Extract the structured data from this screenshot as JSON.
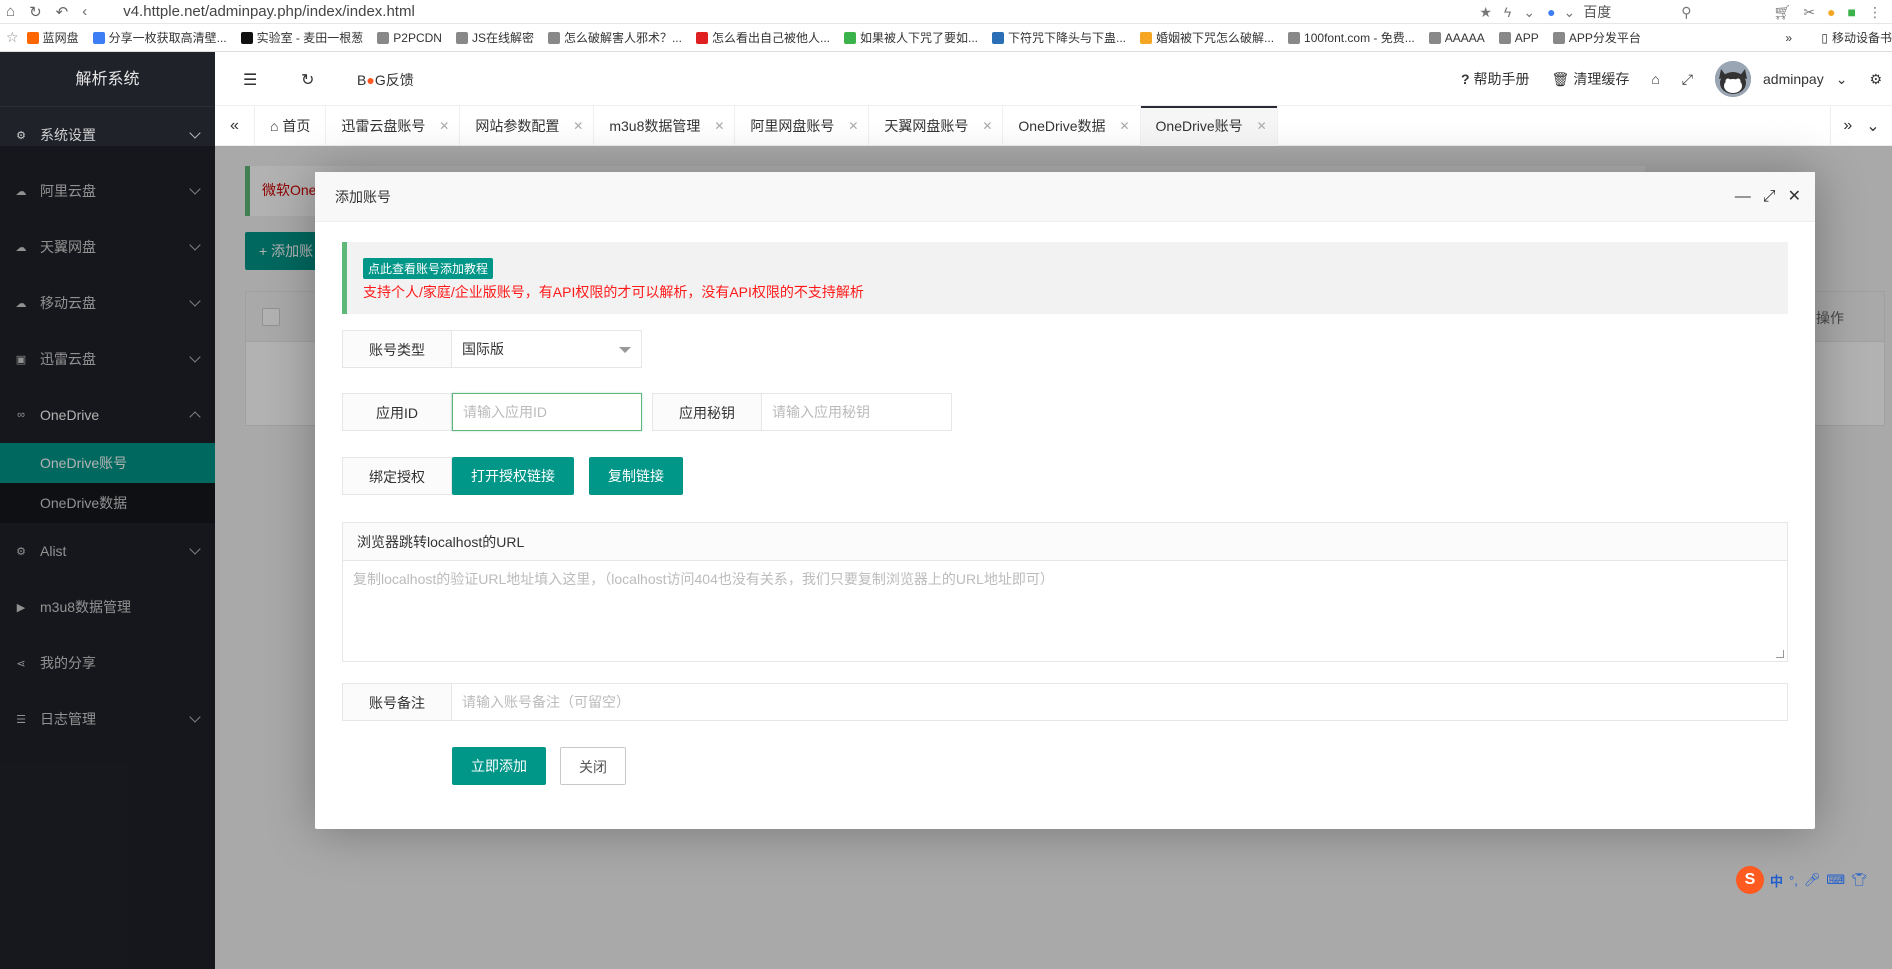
{
  "browser": {
    "url": "v4.httple.net/adminpay.php/index/index.html",
    "search_engine_label": "百度",
    "bookmarks": [
      {
        "label": "蓝网盘",
        "color": "#ff6600"
      },
      {
        "label": "分享一枚获取高清壁...",
        "color": "#3d7ef5"
      },
      {
        "label": "实验室 - 麦田一根葱",
        "color": "#111111"
      },
      {
        "label": "P2PCDN",
        "color": "#888888"
      },
      {
        "label": "JS在线解密",
        "color": "#888888"
      },
      {
        "label": "怎么破解害人邪术？...",
        "color": "#888888"
      },
      {
        "label": "怎么看出自己被他人...",
        "color": "#e02020"
      },
      {
        "label": "如果被人下咒了要如...",
        "color": "#3bb34a"
      },
      {
        "label": "下符咒下降头与下蛊...",
        "color": "#2a6fb5"
      },
      {
        "label": "婚姻被下咒怎么破解...",
        "color": "#f5a623"
      },
      {
        "label": "100font.com - 免费...",
        "color": "#888888"
      },
      {
        "label": "AAAAA",
        "color": "#888888"
      },
      {
        "label": "APP",
        "color": "#888888"
      },
      {
        "label": "APP分发平台",
        "color": "#888888"
      }
    ],
    "bookmarks_more": "»",
    "mobile_bookmarks": "移动设备书"
  },
  "sidebar": {
    "title": "解析系统",
    "items": [
      {
        "label": "系统设置",
        "icon": "gear-icon"
      },
      {
        "label": "阿里云盘",
        "icon": "cloud-icon"
      },
      {
        "label": "天翼网盘",
        "icon": "cloud-icon"
      },
      {
        "label": "移动云盘",
        "icon": "cloud-sync-icon"
      },
      {
        "label": "迅雷云盘",
        "icon": "thunder-icon"
      },
      {
        "label": "OneDrive",
        "icon": "link-icon"
      }
    ],
    "onedrive_sub": [
      "OneDrive账号",
      "OneDrive数据"
    ],
    "items_after": [
      {
        "label": "Alist",
        "icon": "gear-icon"
      },
      {
        "label": "m3u8数据管理",
        "icon": "play-icon"
      },
      {
        "label": "我的分享",
        "icon": "share-icon"
      },
      {
        "label": "日志管理",
        "icon": "log-icon"
      }
    ]
  },
  "header": {
    "bug_label_pre": "B",
    "bug_label_post": "G反馈",
    "help": "帮助手册",
    "clear_cache": "清理缓存",
    "username": "adminpay"
  },
  "tabs": [
    {
      "label": "首页"
    },
    {
      "label": "迅雷云盘账号"
    },
    {
      "label": "网站参数配置"
    },
    {
      "label": "m3u8数据管理"
    },
    {
      "label": "阿里网盘账号"
    },
    {
      "label": "天翼网盘账号"
    },
    {
      "label": "OneDrive数据"
    },
    {
      "label": "OneDrive账号",
      "active": true
    }
  ],
  "page": {
    "notice_text": "微软One",
    "add_button": "+ 添加账",
    "ops_header": "操作"
  },
  "modal": {
    "title": "添加账号",
    "tip_badge": "点此查看账号添加教程",
    "tip_text": "支持个人/家庭/企业版账号，有API权限的才可以解析，没有API权限的不支持解析",
    "account_type_label": "账号类型",
    "account_type_value": "国际版",
    "app_id_label": "应用ID",
    "app_id_placeholder": "请输入应用ID",
    "app_secret_label": "应用秘钥",
    "app_secret_placeholder": "请输入应用秘钥",
    "bind_label": "绑定授权",
    "open_auth_button": "打开授权链接",
    "copy_link_button": "复制链接",
    "redirect_label": "浏览器跳转localhost的URL",
    "redirect_placeholder": "复制localhost的验证URL地址填入这里，（localhost访问404也没有关系，我们只要复制浏览器上的URL地址即可）",
    "remark_label": "账号备注",
    "remark_placeholder": "请输入账号备注（可留空）",
    "submit_button": "立即添加",
    "close_button": "关闭"
  },
  "ime": {
    "lang": "中"
  }
}
